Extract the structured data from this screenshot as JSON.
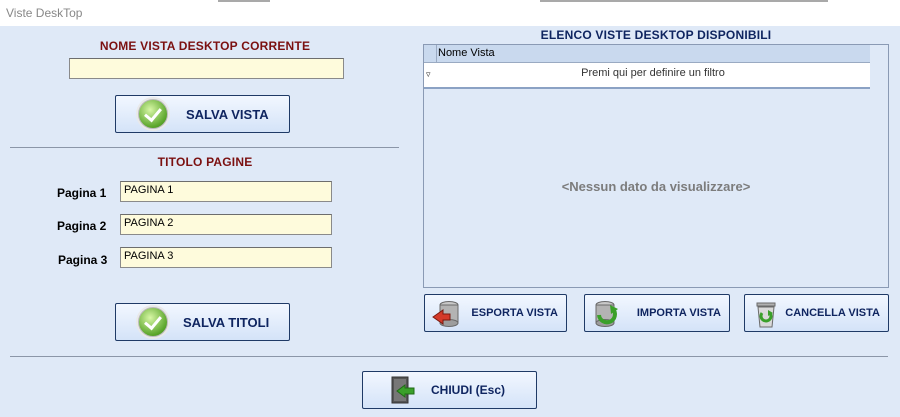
{
  "window": {
    "title": "Viste DeskTop"
  },
  "current_view": {
    "heading": "NOME VISTA DESKTOP CORRENTE",
    "name_value": "",
    "save_button": "SALVA VISTA"
  },
  "page_titles": {
    "heading": "TITOLO PAGINE",
    "pages": [
      {
        "label": "Pagina 1",
        "value": "PAGINA 1"
      },
      {
        "label": "Pagina 2",
        "value": "PAGINA 2"
      },
      {
        "label": "Pagina 3",
        "value": "PAGINA 3"
      }
    ],
    "save_button": "SALVA TITOLI"
  },
  "views_list": {
    "heading": "ELENCO VISTE DESKTOP  DISPONIBILI",
    "column_header": "Nome Vista",
    "filter_row": "Premi qui per definire un filtro",
    "empty_text": "<Nessun dato da visualizzare>",
    "rows": []
  },
  "actions": {
    "export": "ESPORTA VISTA",
    "import": "IMPORTA VISTA",
    "delete": "CANCELLA VISTA"
  },
  "close_button": "CHIUDI  (Esc)",
  "icons": {
    "save": "check-icon",
    "export": "database-export-icon",
    "import": "database-import-icon",
    "delete": "recycle-bin-icon",
    "close": "exit-door-icon",
    "filter": "filter-icon"
  }
}
